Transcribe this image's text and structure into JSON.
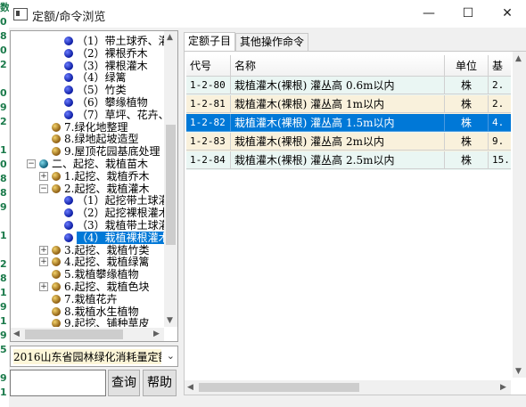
{
  "window": {
    "title": "定额/命令浏览",
    "minimize": "—",
    "maximize": "☐",
    "close": "✕"
  },
  "left_strip": [
    "数",
    "0",
    "8",
    "0",
    "2",
    "",
    "0",
    "9",
    "2",
    "",
    "1",
    "0",
    "8",
    "8",
    "9",
    "",
    "1",
    "",
    "2",
    "8",
    "1",
    "9",
    "1",
    "9",
    "5",
    "",
    "9",
    "1"
  ],
  "tree": [
    {
      "label": "（1）带土球乔、灌",
      "icon": "blue"
    },
    {
      "label": "（2）裸根乔木",
      "icon": "blue"
    },
    {
      "label": "（3）裸根灌木",
      "icon": "blue"
    },
    {
      "label": "（4）绿篱",
      "icon": "blue"
    },
    {
      "label": "（5）竹类",
      "icon": "blue"
    },
    {
      "label": "（6）攀缘植物",
      "icon": "blue"
    },
    {
      "label": "（7）草坪、花卉、",
      "icon": "blue"
    },
    {
      "label": "7.绿化地整理",
      "icon": "gold"
    },
    {
      "label": "8.绿地起坡造型",
      "icon": "gold"
    },
    {
      "label": "9.屋顶花园基底处理",
      "icon": "gold"
    },
    {
      "label": "二、起挖、栽植苗木",
      "icon": "teal",
      "expander": "−"
    },
    {
      "label": "1.起挖、栽植乔木",
      "icon": "gold",
      "expander": "+"
    },
    {
      "label": "2.起挖、栽植灌木",
      "icon": "gold",
      "expander": "−"
    },
    {
      "label": "（1）起挖带土球灌",
      "icon": "blue"
    },
    {
      "label": "（2）起挖裸根灌木",
      "icon": "blue"
    },
    {
      "label": "（3）栽植带土球灌",
      "icon": "blue"
    },
    {
      "label": "（4）栽植裸根灌木",
      "icon": "blue",
      "selected": true
    },
    {
      "label": "3.起挖、栽植竹类",
      "icon": "gold",
      "expander": "+"
    },
    {
      "label": "4.起挖、栽植绿篱",
      "icon": "gold",
      "expander": "+"
    },
    {
      "label": "5.栽植攀缘植物",
      "icon": "gold"
    },
    {
      "label": "6.起挖、栽植色块",
      "icon": "gold",
      "expander": "+"
    },
    {
      "label": "7.栽植花卉",
      "icon": "gold"
    },
    {
      "label": "8.栽植水生植物",
      "icon": "gold"
    },
    {
      "label": "9.起挖、铺种草皮",
      "icon": "gold"
    }
  ],
  "quota_select": {
    "value": "2016山东省园林绿化消耗量定额"
  },
  "search": {
    "value": "",
    "query_label": "查询",
    "help_label": "帮助"
  },
  "tabs": [
    {
      "label": "定额子目",
      "active": true
    },
    {
      "label": "其他操作命令",
      "active": false
    }
  ],
  "table": {
    "columns": {
      "code": "代号",
      "name": "名称",
      "unit": "单位",
      "base": "基"
    },
    "rows": [
      {
        "code": "1-2-80",
        "name": "栽植灌木(裸根) 灌丛高 0.6m以内",
        "unit": "株",
        "base": "2."
      },
      {
        "code": "1-2-81",
        "name": "栽植灌木(裸根) 灌丛高 1m以内",
        "unit": "株",
        "base": "2."
      },
      {
        "code": "1-2-82",
        "name": "栽植灌木(裸根) 灌丛高 1.5m以内",
        "unit": "株",
        "base": "4.",
        "selected": true
      },
      {
        "code": "1-2-83",
        "name": "栽植灌木(裸根) 灌丛高 2m以内",
        "unit": "株",
        "base": "9."
      },
      {
        "code": "1-2-84",
        "name": "栽植灌木(裸根) 灌丛高 2.5m以内",
        "unit": "株",
        "base": "15."
      }
    ]
  },
  "colors": {
    "selection": "#0078d7",
    "row_even": "#eaf6f3",
    "row_odd": "#f9f1dc"
  }
}
